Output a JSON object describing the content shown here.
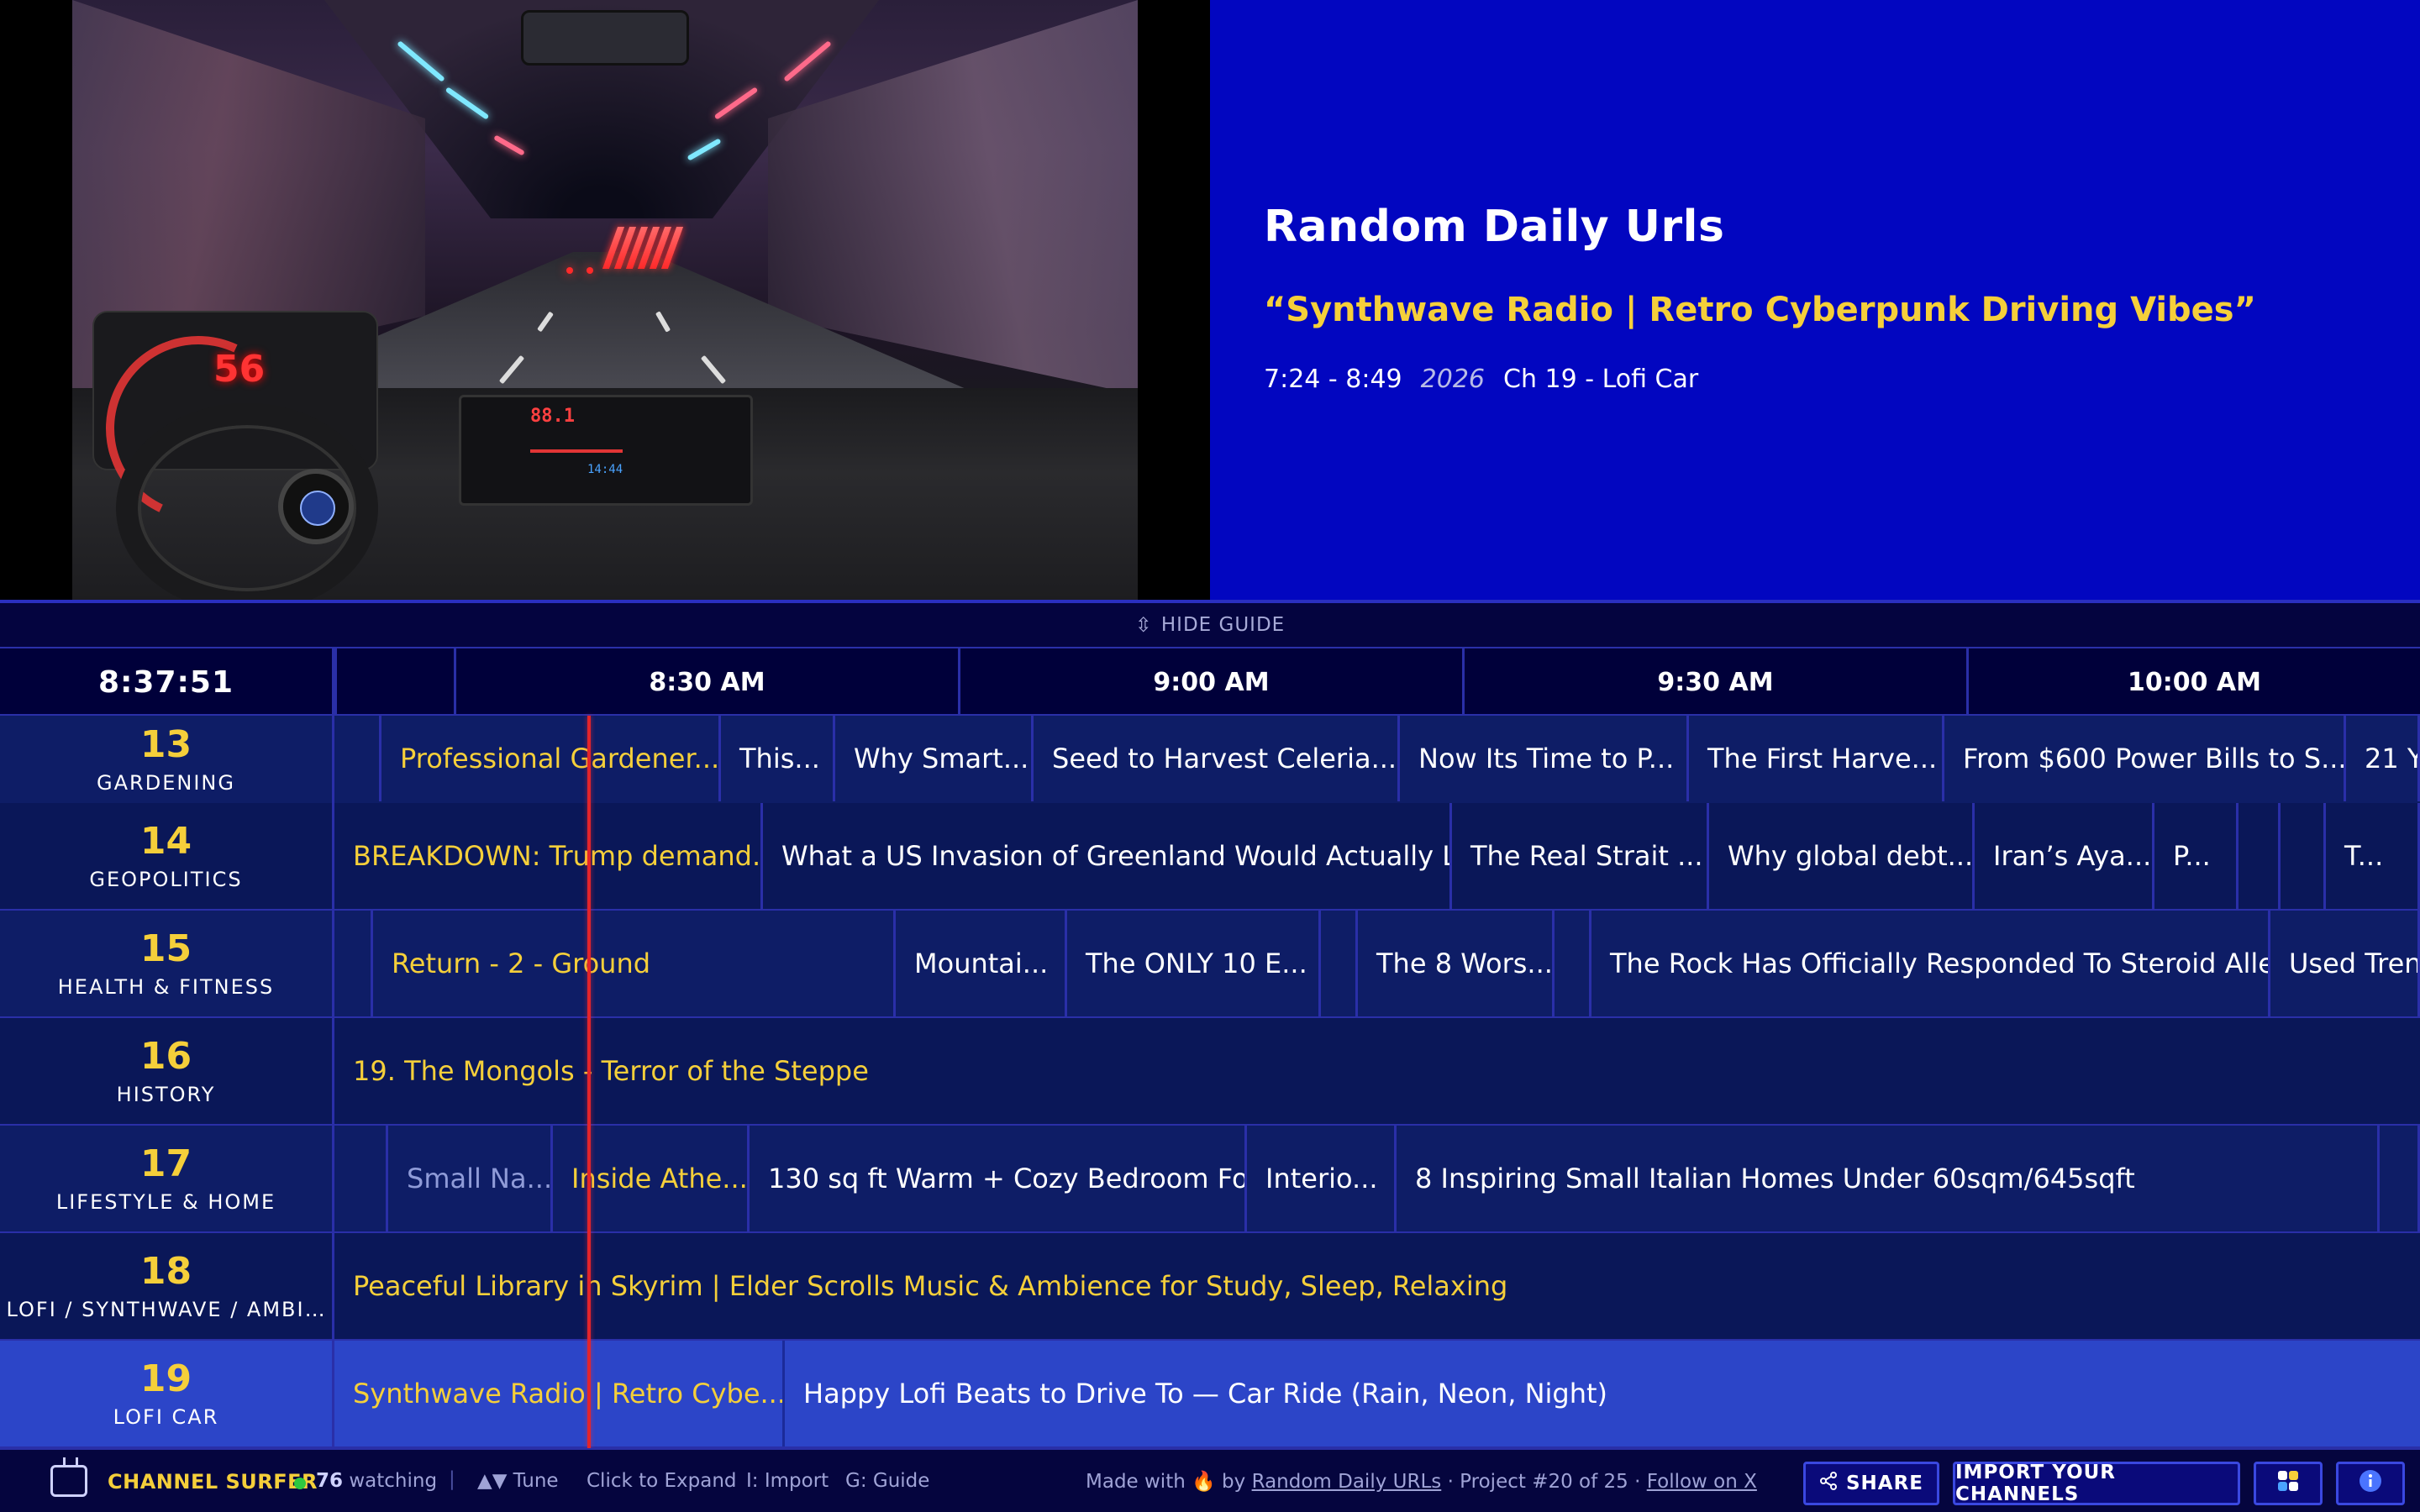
{
  "now_playing": {
    "channel_name": "Random Daily Urls",
    "title": "“Synthwave Radio | Retro Cyberpunk Driving Vibes”",
    "time_range": "7:24 - 8:49",
    "year": "2026",
    "channel": "Ch 19 - Lofi Car"
  },
  "video": {
    "speed": "56",
    "console_readout": "88.1",
    "console_clock": "14:44"
  },
  "guide": {
    "hide_label": "HIDE GUIDE",
    "clock": "8:37:51",
    "time_slots": [
      "8:30 AM",
      "9:00 AM",
      "9:30 AM",
      "10:00 AM"
    ],
    "rows": [
      {
        "num": "13",
        "name": "GARDENING",
        "programs": [
          "",
          "Professional Gardener...",
          "This...",
          "Why Smart...",
          "Seed to Harvest Celeria...",
          "Now Its Time to P...",
          "The First Harve...",
          "From $600 Power Bills to S...",
          "21 Y"
        ]
      },
      {
        "num": "14",
        "name": "GEOPOLITICS",
        "programs": [
          "BREAKDOWN: Trump demand...",
          "What a US Invasion of Greenland Would Actually L...",
          "The Real Strait ...",
          "Why global debt...",
          "Iran’s Aya...",
          "P...",
          "",
          "",
          "T..."
        ]
      },
      {
        "num": "15",
        "name": "HEALTH & FITNESS",
        "programs": [
          "",
          "Return - 2 - Ground",
          "Mountai...",
          "The ONLY 10 E...",
          "",
          "The 8 Wors...",
          "",
          "The Rock Has Officially Responded To Steroid Alle...",
          "Used Tren"
        ]
      },
      {
        "num": "16",
        "name": "HISTORY",
        "programs": [
          "19. The Mongols - Terror of the Steppe"
        ]
      },
      {
        "num": "17",
        "name": "LIFESTYLE & HOME",
        "programs": [
          "",
          "Small Na...",
          "Inside Athe...",
          "130 sq ft Warm + Cozy Bedroom Fo...",
          "Interio...",
          "8 Inspiring Small Italian Homes Under 60sqm/645sqft",
          ""
        ]
      },
      {
        "num": "18",
        "name": "LOFI / SYNTHWAVE / AMBI...",
        "programs": [
          "Peaceful Library in Skyrim | Elder Scrolls Music & Ambience for Study, Sleep, Relaxing"
        ]
      },
      {
        "num": "19",
        "name": "LOFI CAR",
        "programs": [
          "Synthwave Radio | Retro Cybe...",
          "Happy Lofi Beats to Drive To — Car Ride (Rain, Neon, Night)"
        ]
      }
    ]
  },
  "footer": {
    "brand": "CHANNEL SURFER",
    "watching_count": "76",
    "watching_label": "watching",
    "separator": "|",
    "hints": [
      "▲▼ Tune",
      "Click to Expand",
      "I: Import",
      "G: Guide"
    ],
    "made_with_prefix": "Made with 🔥 by",
    "made_with_link": "Random Daily URLs",
    "project_text": "· Project #20 of 25 ·",
    "follow_link": "Follow on X",
    "share_label": "SHARE",
    "import_label": "IMPORT YOUR CHANNELS"
  },
  "colors": {
    "info_panel_bg": "#0206c0",
    "accent_yellow": "#f5cf3a",
    "now_line": "#e3242b",
    "active_row": "#2c45c8"
  },
  "icons": [
    "compress-icon",
    "tv-logo-icon",
    "share-icon",
    "theme-icon",
    "info-icon"
  ]
}
